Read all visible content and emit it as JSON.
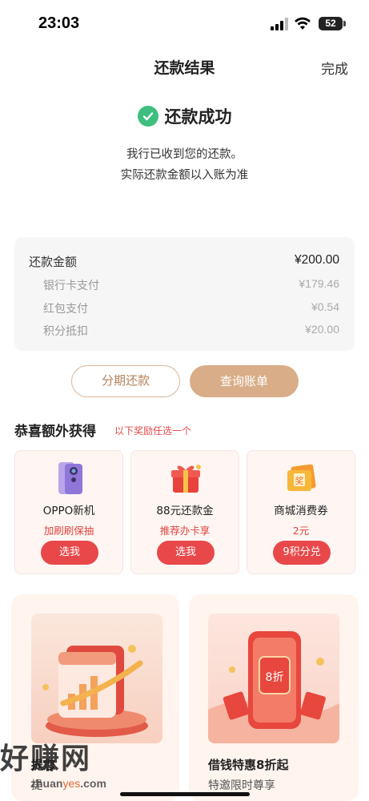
{
  "status_bar": {
    "time": "23:03",
    "battery": "52"
  },
  "nav": {
    "title": "还款结果",
    "done": "完成"
  },
  "result": {
    "title": "还款成功",
    "desc_line1": "我行已收到您的还款。",
    "desc_line2": "实际还款金额以入账为准"
  },
  "amount": {
    "total_label": "还款金额",
    "total_value": "¥200.00",
    "items": [
      {
        "label": "银行卡支付",
        "value": "¥179.46"
      },
      {
        "label": "红包支付",
        "value": "¥0.54"
      },
      {
        "label": "积分抵扣",
        "value": "¥20.00"
      }
    ]
  },
  "buttons": {
    "installment": "分期还款",
    "query_bill": "查询账单"
  },
  "bonus": {
    "title": "恭喜额外获得",
    "subtitle": "以下奖励任选一个",
    "rewards": [
      {
        "name": "OPPO新机",
        "desc": "加刷刷保抽",
        "button": "选我",
        "icon": "phone-icon"
      },
      {
        "name": "88元还款金",
        "desc": "推荐办卡享",
        "button": "选我",
        "icon": "gift-box-icon"
      },
      {
        "name": "商城消费券",
        "desc": "2元",
        "button": "9积分兑",
        "icon": "coupon-icon"
      }
    ]
  },
  "promos": [
    {
      "title": "提您",
      "subtitle": "提",
      "icon": "chart-calendar-icon"
    },
    {
      "title": "借钱特惠8折起",
      "subtitle": "特邀限时尊享",
      "icon": "discount-phone-icon",
      "badge": "8折"
    }
  ],
  "watermark": {
    "brand": "好赚网",
    "url_prefix": "zhuan",
    "url_suffix": "yes",
    "url_tail": ".com"
  },
  "colors": {
    "accent": "#d8ad87",
    "success": "#3fbf7f",
    "red": "#e8484a"
  }
}
